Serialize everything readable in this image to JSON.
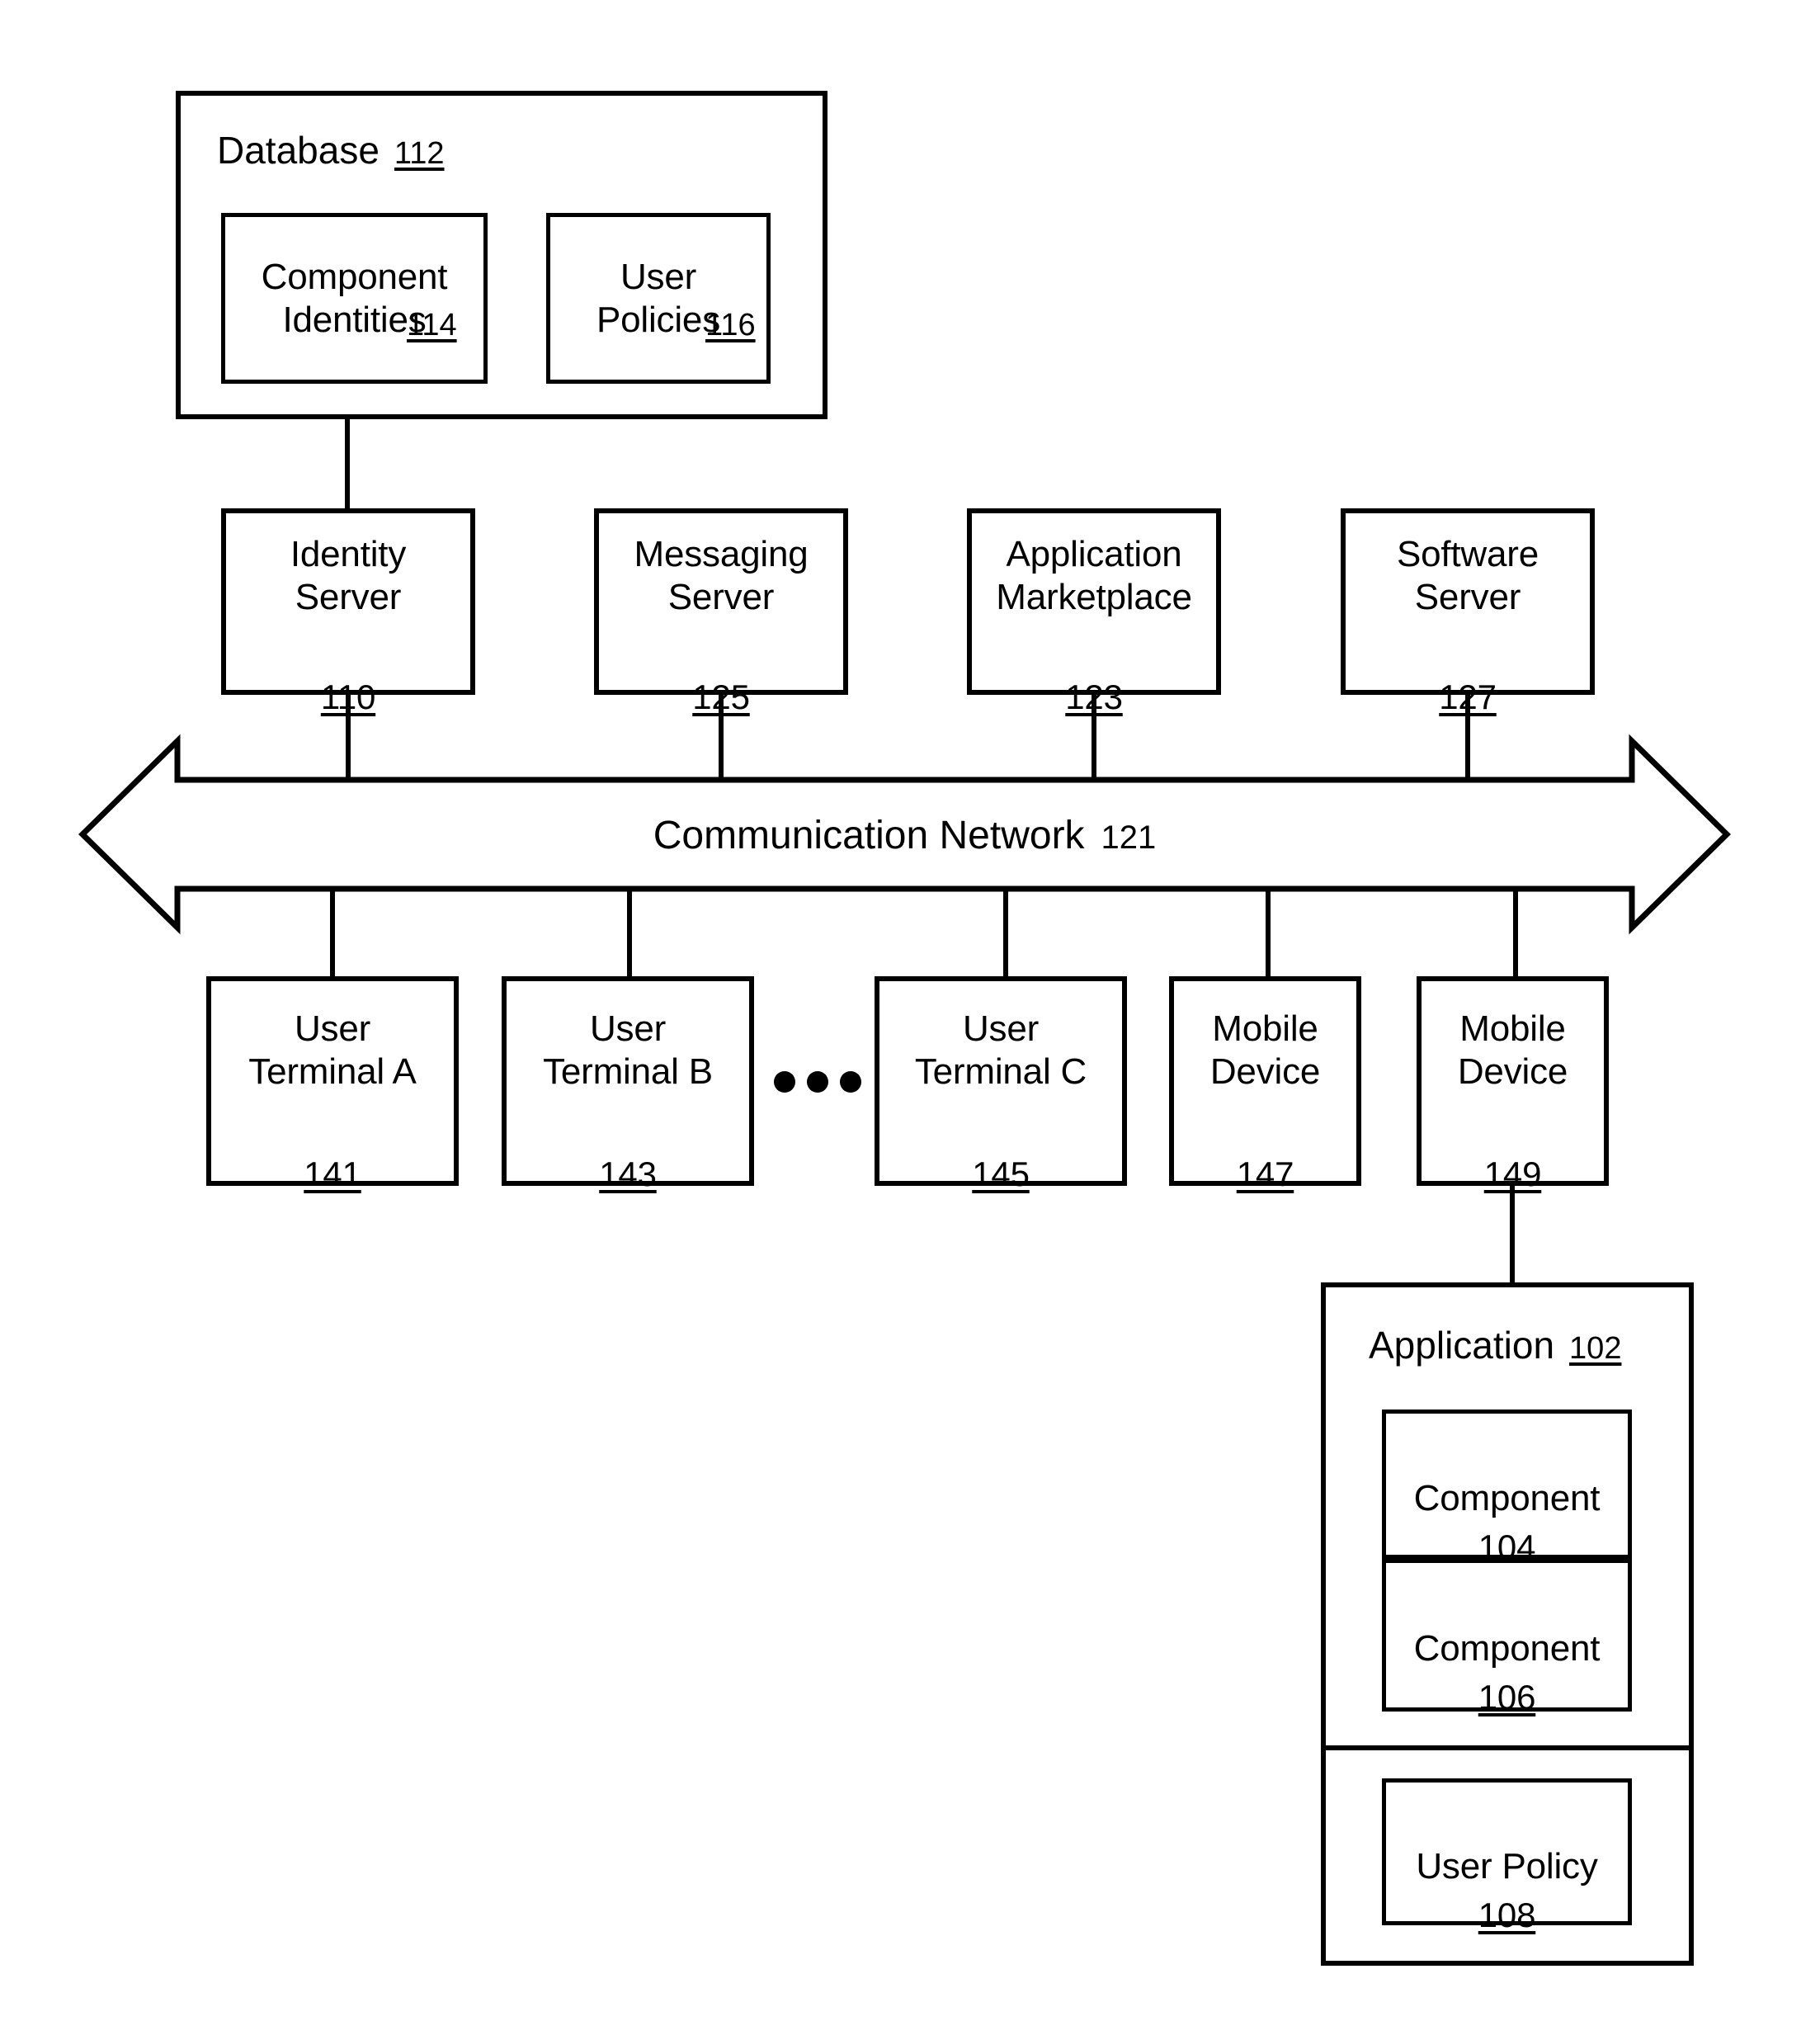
{
  "figure": {
    "type": "system-architecture-block-diagram"
  },
  "database": {
    "title": "Database",
    "ref": "112",
    "children": [
      {
        "label": "Component\nIdentities",
        "ref": "114"
      },
      {
        "label": "User\nPolicies",
        "ref": "116"
      }
    ]
  },
  "servers": [
    {
      "label": "Identity\nServer",
      "ref": "110"
    },
    {
      "label": "Messaging\nServer",
      "ref": "125"
    },
    {
      "label": "Application\nMarketplace",
      "ref": "123"
    },
    {
      "label": "Software\nServer",
      "ref": "127"
    }
  ],
  "network": {
    "label": "Communication Network",
    "ref": "121"
  },
  "endpoints": [
    {
      "label": "User\nTerminal A",
      "ref": "141"
    },
    {
      "label": "User\nTerminal B",
      "ref": "143"
    },
    {
      "label": "User\nTerminal C",
      "ref": "145"
    },
    {
      "label": "Mobile\nDevice",
      "ref": "147"
    },
    {
      "label": "Mobile\nDevice",
      "ref": "149"
    }
  ],
  "ellipsis": "•••",
  "application": {
    "title": "Application",
    "ref": "102",
    "components": [
      {
        "label": "Component",
        "ref": "104"
      },
      {
        "label": "Component",
        "ref": "106"
      }
    ],
    "policy": {
      "label": "User Policy",
      "ref": "108"
    }
  },
  "colors": {
    "stroke": "#000000",
    "background": "#ffffff"
  }
}
